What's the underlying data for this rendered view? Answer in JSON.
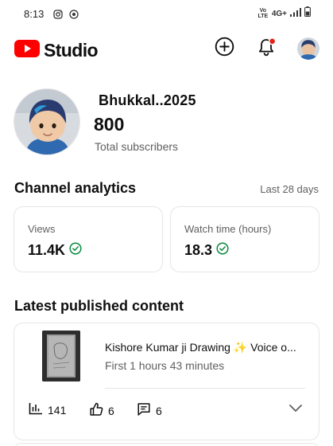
{
  "status_bar": {
    "time": "8:13",
    "network": "4G+",
    "volte": "Vo LTE",
    "icons": [
      "instagram-icon",
      "record-icon",
      "signal-icon",
      "battery-icon"
    ]
  },
  "header": {
    "app_name": "Studio",
    "brand_color": "#ff0000",
    "actions": [
      "create-icon",
      "bell-icon",
      "avatar"
    ],
    "notification_dot_color": "#e62117"
  },
  "profile": {
    "channel_name": "Bhukkal..2025",
    "subscriber_count": "800",
    "subscriber_label": "Total subscribers"
  },
  "analytics": {
    "title": "Channel analytics",
    "period": "Last 28 days",
    "cards": [
      {
        "label": "Views",
        "value": "11.4K",
        "status_icon": "check-circle-icon"
      },
      {
        "label": "Watch time (hours)",
        "value": "18.3",
        "status_icon": "check-circle-icon"
      }
    ],
    "status_color": "#0a8a3c"
  },
  "latest": {
    "title": "Latest published content",
    "video": {
      "title": "Kishore Kumar ji Drawing ✨ Voice o...",
      "duration": "First 1 hours 43 minutes",
      "views": "141",
      "likes": "6",
      "comments": "6"
    }
  }
}
